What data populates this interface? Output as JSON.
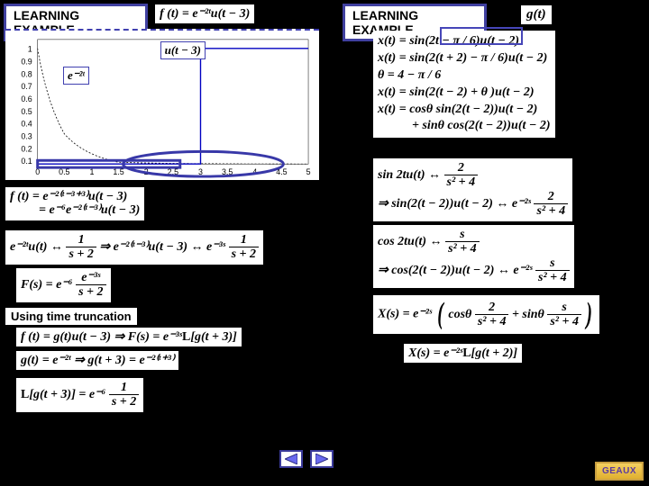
{
  "headers": {
    "left": "LEARNING EXAMPLE",
    "right": "LEARNING EXAMPLE"
  },
  "gt": "g(t)",
  "ft_header": "f (t) = e⁻²ᵗu(t − 3)",
  "chart_ann": {
    "u": "u(t − 3)",
    "e": "e⁻²ᵗ"
  },
  "chart_data": {
    "type": "line",
    "xlabel": "",
    "ylabel": "",
    "xlim": [
      0,
      5
    ],
    "ylim": [
      0,
      1
    ],
    "x_ticks": [
      0,
      0.5,
      1,
      1.5,
      2,
      2.5,
      3,
      3.5,
      4,
      4.5,
      5
    ],
    "y_ticks": [
      0.1,
      0.2,
      0.3,
      0.4,
      0.5,
      0.6,
      0.7,
      0.8,
      0.9,
      1
    ],
    "series": [
      {
        "name": "u(t-3)",
        "x": [
          0,
          3,
          3,
          5
        ],
        "y": [
          0,
          0,
          1,
          1
        ],
        "style": "solid"
      },
      {
        "name": "e^{-2t}",
        "x": [
          0,
          0.25,
          0.5,
          0.75,
          1,
          1.25,
          1.5,
          2,
          3,
          5
        ],
        "y": [
          1,
          0.607,
          0.368,
          0.223,
          0.135,
          0.082,
          0.05,
          0.018,
          0.0025,
          5e-05
        ],
        "style": "dotted"
      }
    ]
  },
  "left_eqs": {
    "e1a": "f (t) = e⁻²⁽ᵗ⁻³⁺³⁾u(t − 3)",
    "e1b": "= e⁻⁶e⁻²⁽ᵗ⁻³⁾u(t − 3)",
    "e2_lhs": "e⁻²ᵗu(t) ↔",
    "e2_f1n": "1",
    "e2_f1d": "s + 2",
    "e2_mid": " ⇒ e⁻²⁽ᵗ⁻³⁾u(t − 3) ↔ e⁻³ˢ",
    "e2_f2n": "1",
    "e2_f2d": "s + 2",
    "e3_lhs": "F(s) = e⁻⁶",
    "e3_fn": "e⁻³ˢ",
    "e3_fd": "s + 2"
  },
  "subsection": "Using time truncation",
  "trunc_eqs": {
    "t1": "f (t) = g(t)u(t − 3) ⇒ F(s) = e⁻³ˢ",
    "t1_L": "L",
    "t1_br": "[g(t + 3)]",
    "t2a": "g(t) = e⁻²ᵗ ⇒ g(t + 3) = e⁻²⁽ᵗ⁺³⁾",
    "t3_L": "L",
    "t3_lhs": "[g(t + 3)] = e⁻⁶",
    "t3_fn": "1",
    "t3_fd": "s + 2"
  },
  "right_eqs": {
    "r1a": "x(t) = sin(2t − π / 6)u(t − 2)",
    "r1b": "x(t) = sin(2(t + 2) − π / 6)u(t − 2)",
    "r1c": "θ = 4 − π / 6",
    "r1d": "x(t) = sin(2(t − 2) + θ )u(t − 2)",
    "r1e": "x(t) = cosθ sin(2(t − 2))u(t − 2)",
    "r1f": "+ sinθ cos(2(t − 2))u(t − 2)",
    "r2a": "sin 2tu(t) ↔",
    "r2fn": "2",
    "r2fd": "s² + 4",
    "r2b": "⇒ sin(2(t − 2))u(t − 2) ↔ e⁻²ˢ",
    "r3a": "cos 2tu(t) ↔",
    "r3fn": "s",
    "r3fd": "s² + 4",
    "r3b": "⇒ cos(2(t − 2))u(t − 2) ↔ e⁻²ˢ",
    "r4_lhs": "X(s) = e⁻²ˢ",
    "r4_mid1": "cosθ",
    "r4_f1n": "2",
    "r4_f1d": "s² + 4",
    "r4_mid2": "+ sinθ",
    "r4_f2n": "s",
    "r4_f2d": "s² + 4",
    "r5": "X(s) = e⁻²ˢ",
    "r5_L": "L",
    "r5_br": "[g(t + 2)]"
  },
  "geaux": "GEAUX"
}
